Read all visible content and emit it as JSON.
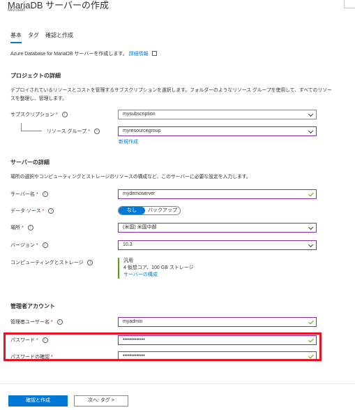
{
  "header": {
    "title": "MariaDB サーバーの作成",
    "subtitle": "Microsoft"
  },
  "tabs": [
    {
      "label": "基本",
      "active": true
    },
    {
      "label": "タグ",
      "active": false
    },
    {
      "label": "確認と作成",
      "active": false
    }
  ],
  "intro": {
    "text": "Azure Database for MariaDB サーバーを作成します。",
    "link": "詳細情報"
  },
  "project": {
    "title": "プロジェクトの詳細",
    "desc_line1": "デプロイされているリソースとコストを管理するサブスクリプションを選択します。フォルダーのようなリソース グループを使用して、すべてのリソー",
    "desc_line2": "スを整理し、管理します。",
    "subscription_label": "サブスクリプション",
    "subscription_value": "mysubscription",
    "rg_label": "リソース グループ",
    "rg_value": "myresourcegroup",
    "rg_new": "新規作成"
  },
  "server": {
    "title": "サーバーの詳細",
    "desc": "場所の選択やコンピューティングとストレージのリソースの構成など、このサーバーに必要な設定を入力します。",
    "name_label": "サーバー名",
    "name_value": "mydemoserver",
    "source_label": "データ ソース",
    "source_on": "なし",
    "source_off": "バックアップ",
    "location_label": "場所",
    "location_value": "(米国) 米国中部",
    "version_label": "バージョン",
    "version_value": "10.3",
    "compute_label": "コンピューティングとストレージ",
    "compute_tier": "汎用",
    "compute_spec": "4 仮想コア、100 GB ストレージ",
    "compute_link": "サーバーの構成"
  },
  "admin": {
    "title": "管理者アカウント",
    "user_label": "管理者ユーザー名",
    "user_value": "myadmin",
    "pw_label": "パスワード",
    "pw_value": "•••••••••••••",
    "pw_confirm_label": "パスワードの確認",
    "pw_confirm_value": "•••••••••••••"
  },
  "footer": {
    "primary": "確認と作成",
    "secondary": "次へ: タグ >"
  },
  "colors": {
    "accent": "#0078d4",
    "valid": "#57a300",
    "highlight": "#e81123"
  }
}
